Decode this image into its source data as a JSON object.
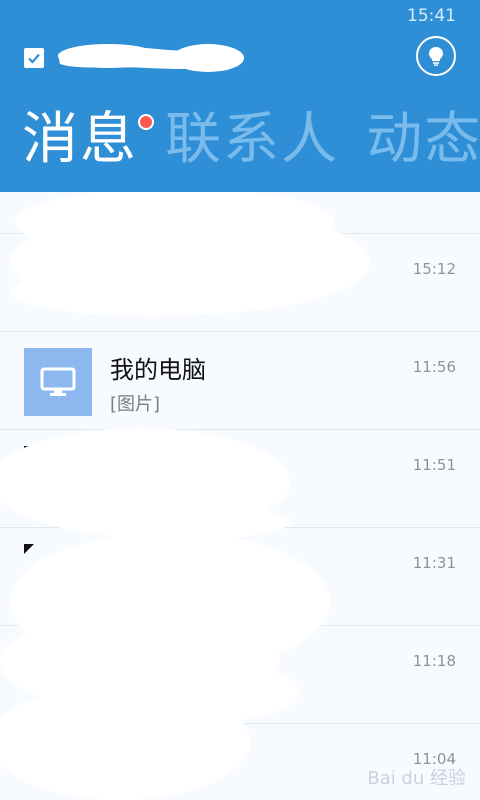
{
  "status_bar": {
    "time": "15:41"
  },
  "header": {
    "tabs": [
      {
        "label": "消息",
        "active": true,
        "has_badge": true
      },
      {
        "label": "联系人",
        "active": false
      },
      {
        "label": "动态",
        "active": false
      }
    ]
  },
  "colors": {
    "header_bg": "#2f8fd6",
    "tab_active": "#ffffff",
    "tab_inactive": "#79bceb",
    "badge": "#ff5a4f",
    "pc_avatar_bg": "#8db8ef",
    "list_bg": "#f7fbff"
  },
  "icons": {
    "account_check": "check-icon",
    "tips": "lightbulb-icon",
    "pc_avatar": "monitor-icon"
  },
  "conversations": [
    {
      "name": "",
      "preview": "",
      "time": "15:12",
      "redacted": true
    },
    {
      "name": "我的电脑",
      "preview": "[图片]",
      "time": "11:56",
      "redacted": false
    },
    {
      "name": "",
      "preview": "",
      "time": "11:51",
      "redacted": true
    },
    {
      "name": "",
      "preview": "",
      "time": "11:31",
      "redacted": true
    },
    {
      "name": "",
      "preview": "",
      "time": "11:18",
      "redacted": true
    },
    {
      "name": "",
      "preview": "",
      "time": "11:04",
      "redacted": true
    }
  ],
  "watermark": "Bai du 经验"
}
